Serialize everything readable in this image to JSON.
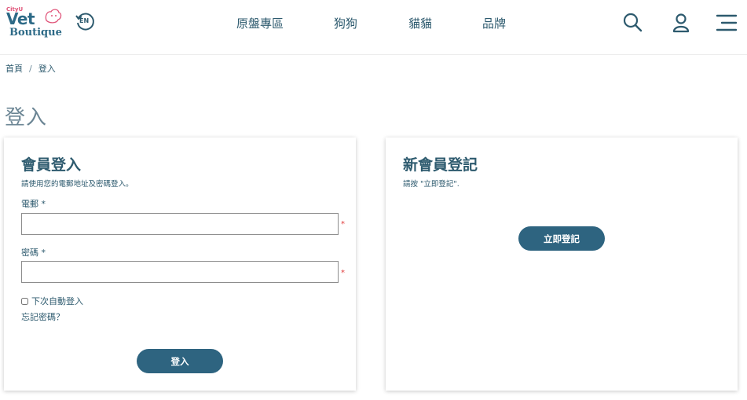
{
  "logo": {
    "city": "CityU",
    "vet": "Vet",
    "boutique": "Boutique"
  },
  "header": {
    "lang_label": "EN",
    "nav": [
      "原盤專區",
      "狗狗",
      "貓貓",
      "品牌"
    ],
    "icons": [
      "search-icon",
      "user-icon",
      "menu-icon"
    ]
  },
  "breadcrumb": {
    "home": "首頁",
    "separator": "/",
    "current": "登入"
  },
  "page_title": "登入",
  "login": {
    "title": "會員登入",
    "subtitle": "請使用您的電郵地址及密碼登入。",
    "email_label": "電郵",
    "password_label": "密碼",
    "required_marker": "*",
    "email_value": "",
    "password_value": "",
    "remember_label": "下次自動登入",
    "forgot_label": "忘記密碼？",
    "submit_label": "登入"
  },
  "register": {
    "title": "新會員登記",
    "subtitle": "請按 \"立即登記\".",
    "button_label": "立即登記"
  },
  "colors": {
    "primary": "#2e6480",
    "text": "#2d5a6e",
    "required": "#e03a3a",
    "logo_pink": "#e0557a"
  }
}
